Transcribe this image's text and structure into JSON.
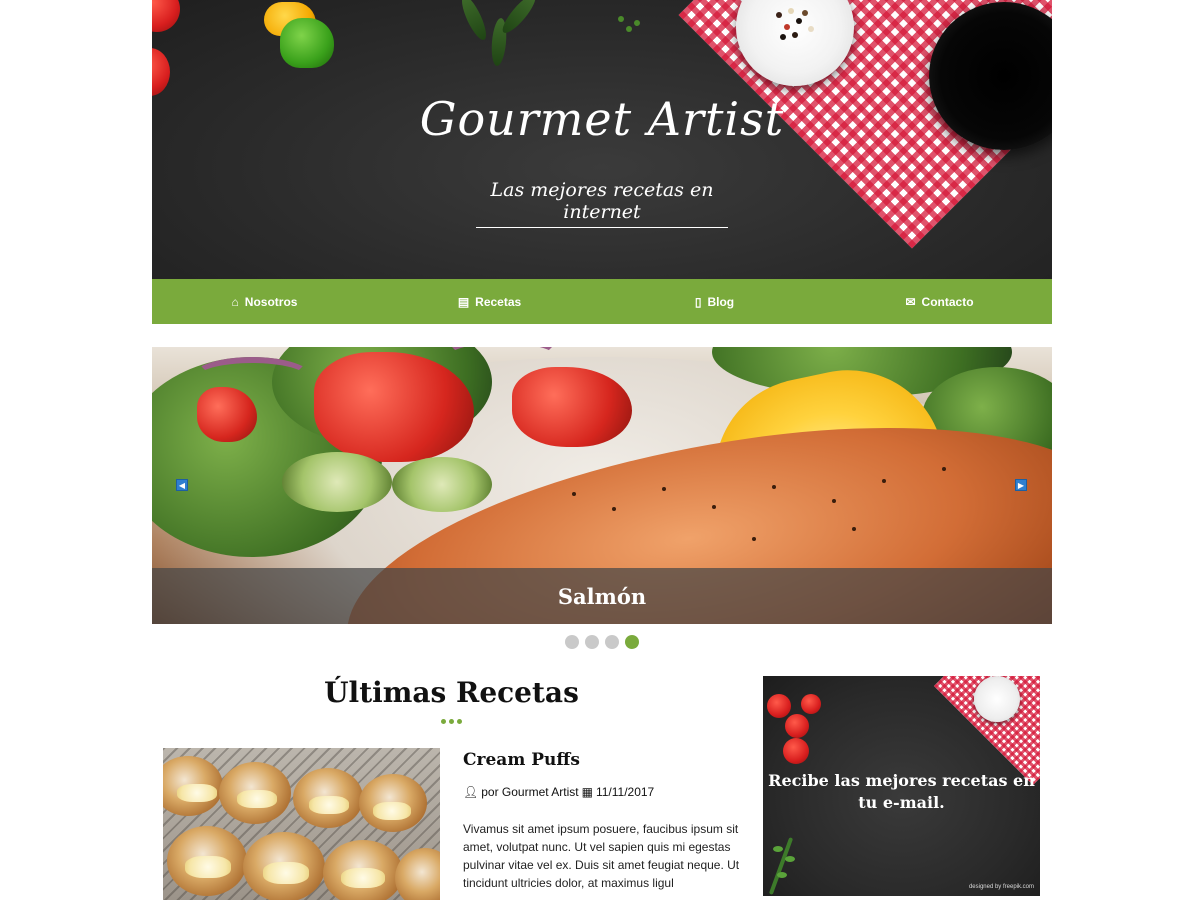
{
  "header": {
    "title": "Gourmet Artist",
    "tagline": "Las mejores recetas en internet"
  },
  "nav": {
    "items": [
      {
        "label": "Nosotros",
        "icon": "home-icon"
      },
      {
        "label": "Recetas",
        "icon": "document-icon"
      },
      {
        "label": "Blog",
        "icon": "file-icon"
      },
      {
        "label": "Contacto",
        "icon": "envelope-icon"
      }
    ]
  },
  "slider": {
    "caption": "Salmón",
    "prev_icon": "◀",
    "next_icon": "▶",
    "slide_count": 4,
    "active_slide": 4
  },
  "latest": {
    "title": "Últimas Recetas",
    "recipe": {
      "title": "Cream Puffs",
      "author": "por Gourmet Artist",
      "date": "11/11/2017",
      "excerpt": "Vivamus sit amet ipsum posuere, faucibus ipsum sit amet, volutpat nunc. Ut vel sapien quis mi egestas pulvinar vitae vel ex. Duis sit amet feugiat neque. Ut tincidunt ultricies dolor, at maximus ligul"
    }
  },
  "banner": {
    "text": "Recibe las mejores recetas en tu e-mail.",
    "credit": "designed by freepik.com"
  },
  "colors": {
    "accent": "#7aaa3c",
    "dark_bg": "#2b2b2b",
    "caption_bg": "#464646"
  }
}
